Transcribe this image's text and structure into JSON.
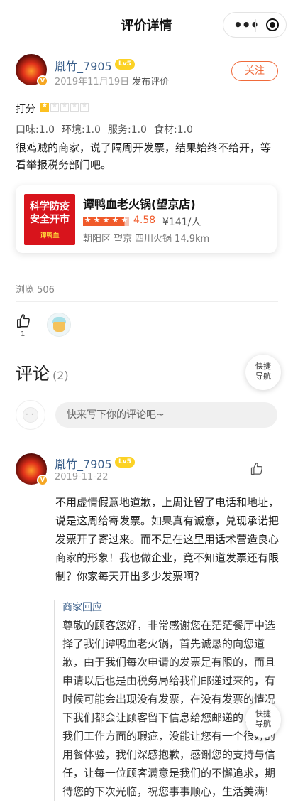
{
  "nav": {
    "title": "评价详情",
    "more_icon": "more-dots-icon",
    "close_icon": "target-circle-icon"
  },
  "review": {
    "user": {
      "name": "胤竹_7905",
      "level": "Lv5",
      "badge": "V"
    },
    "date": "2019年11月19日",
    "date_suffix": "发布评价",
    "follow_label": "关注",
    "score_label": "打分",
    "score_stars": 1,
    "subscores": [
      "口味:1.0",
      "环境:1.0",
      "服务:1.0",
      "食材:1.0"
    ],
    "text": "很鸡贼的商家，说了隔周开发票，结果始终不给开，等看举报税务部门吧。"
  },
  "shop": {
    "image_text": [
      "科学防疫",
      "安全开市",
      "谭鸭血"
    ],
    "name": "谭鸭血老火锅(望京店)",
    "stars": 4.5,
    "rating": "4.58",
    "price": "¥141/人",
    "location": [
      "朝阳区",
      "望京",
      "四川火锅",
      "14.9km"
    ]
  },
  "views": "浏览 506",
  "likes": {
    "count": "1"
  },
  "comments": {
    "title": "评论",
    "count": "(2)",
    "quick_nav": "快捷\n导航",
    "input_placeholder": "快来写下你的评论吧~",
    "items": [
      {
        "user": {
          "name": "胤竹_7905",
          "level": "Lv5",
          "badge": "V"
        },
        "date": "2019-11-22",
        "text": "不用虚情假意地道歉，上周让留了电话和地址，说是这周给寄发票。如果真有诚意，兑现承诺把发票开了寄过来。而不是在这里用话术营造良心商家的形象！我也做企业，竟不知道发票还有限制？你家每天开出多少发票啊？",
        "merchant_label": "商家回应",
        "merchant_text": "尊敬的顾客您好，非常感谢您在茫茫餐厅中选择了我们谭鸭血老火锅，首先诚恳的向您道歉，由于我们每次申请的发票是有限的，而且申请以后也是由税务局给我们邮递过来的，有时候可能会出现没有发票，在没有发票的情况下我们都会让顾客留下信息给您邮递的，由于我们工作方面的瑕疵，没能让您有一个很好的用餐体验，我们深感抱歉，感谢您的支持与信任，让每一位顾客满意是我们的不懈追求，期待您的下次光临，祝您事事顺心，生活美满!"
      }
    ]
  },
  "colors": {
    "accent": "#f06a3a",
    "link": "#3b5f8a",
    "star_yellow": "#fcc020",
    "level_badge": "#fcd225"
  }
}
